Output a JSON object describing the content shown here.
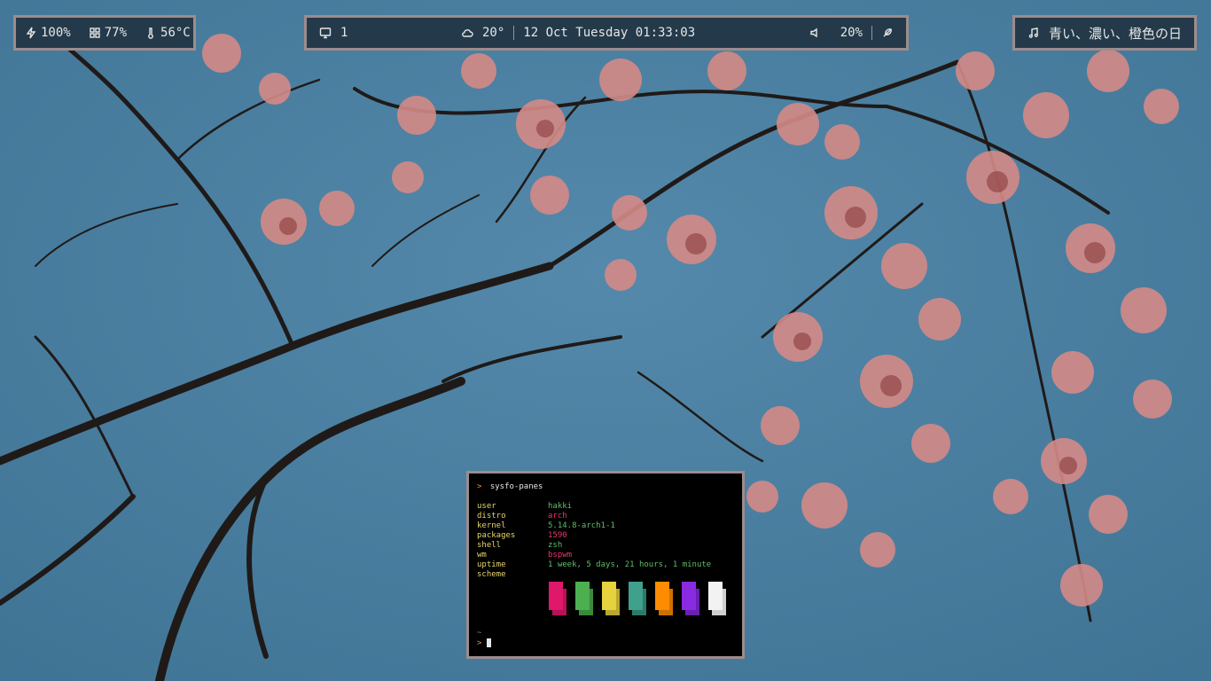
{
  "bar_left": {
    "battery": "100%",
    "memory": "77%",
    "temperature": "56°C"
  },
  "bar_center": {
    "workspace": "1",
    "weather_temp": "20°",
    "datetime": "12 Oct Tuesday 01:33:03",
    "volume": "20%"
  },
  "bar_right": {
    "song": "青い、濃い、橙色の日"
  },
  "terminal": {
    "title": "sysfo-panes",
    "rows": [
      {
        "key": "user",
        "value": "hakki"
      },
      {
        "key": "distro",
        "value": "arch"
      },
      {
        "key": "kernel",
        "value": "5.14.8-arch1-1"
      },
      {
        "key": "packages",
        "value": "1590"
      },
      {
        "key": "shell",
        "value": "zsh"
      },
      {
        "key": "wm",
        "value": "bspwm"
      },
      {
        "key": "uptime",
        "value": "1 week, 5 days, 21 hours, 1 minute"
      },
      {
        "key": "scheme",
        "value": ""
      }
    ],
    "tilde": "~",
    "scheme_colors": [
      "#e0186a",
      "#4caf50",
      "#e6d23c",
      "#3fa08c",
      "#ff8c00",
      "#8a2be2",
      "#f2f2f2"
    ],
    "scheme_shadow": [
      "#b81258",
      "#3a8a3e",
      "#b8a830",
      "#2e7a6a",
      "#cc7000",
      "#6a20b0",
      "#cfcfcf"
    ]
  },
  "icons": {
    "battery": "lightning-icon",
    "memory": "grid-icon",
    "temperature": "thermometer-icon",
    "workspace": "monitor-icon",
    "weather": "cloud-icon",
    "volume": "speaker-icon",
    "launcher": "feather-icon",
    "music": "music-note-icon"
  }
}
